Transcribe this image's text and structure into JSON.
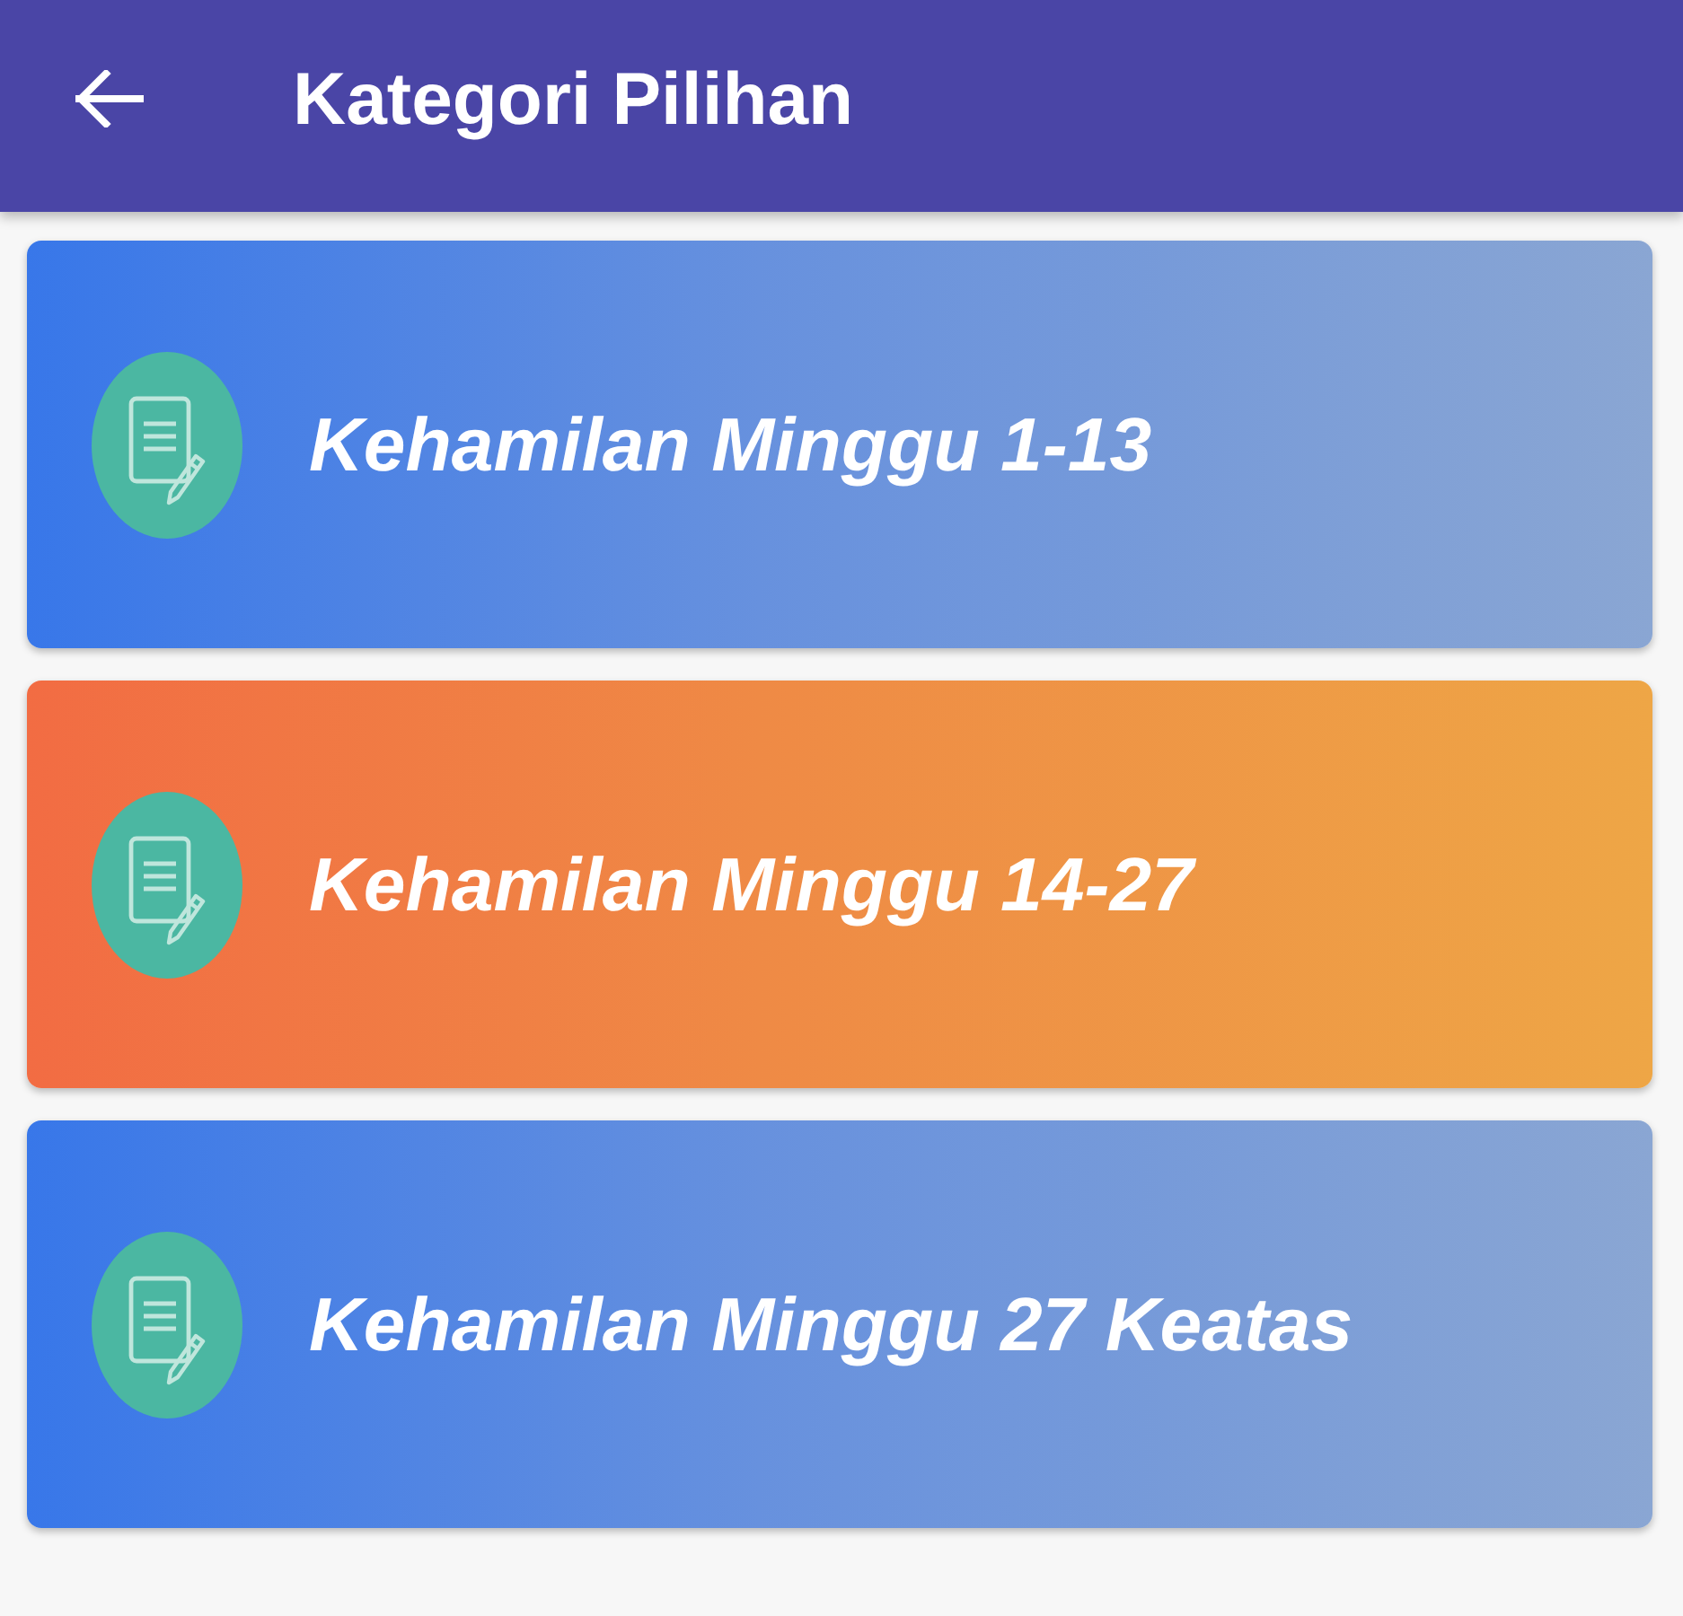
{
  "app_bar": {
    "title": "Kategori Pilihan"
  },
  "categories": [
    {
      "label": "Kehamilan Minggu 1-13",
      "kind": "cool"
    },
    {
      "label": "Kehamilan Minggu 14-27",
      "kind": "warm"
    },
    {
      "label": "Kehamilan Minggu 27 Keatas",
      "kind": "cool"
    }
  ]
}
